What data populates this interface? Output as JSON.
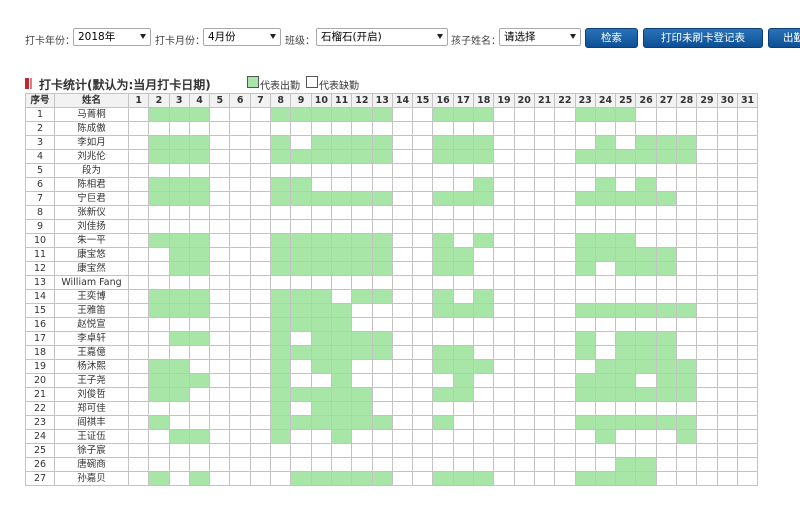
{
  "filters": {
    "year_label": "打卡年份：",
    "year_value": "2018年",
    "month_label": "打卡月份：",
    "month_value": "4月份",
    "class_label": "班级：",
    "class_value": "石榴石(开启)",
    "child_label": "孩子姓名：",
    "child_value": "请选择",
    "search_button": "检索",
    "print_button": "打印未刷卡登记表",
    "extra_button": "出勤"
  },
  "section": {
    "title": "打卡统计(默认为:当月打卡日期)",
    "legend_present": "代表出勤",
    "legend_absent": "代表缺勤"
  },
  "colors": {
    "present": "#a8e6a8",
    "absent": "#ffffff",
    "button": "#1560a8",
    "accent_red": "#c0282d"
  },
  "table": {
    "headers": {
      "seq": "序号",
      "name": "姓名"
    },
    "days": [
      "1",
      "2",
      "3",
      "4",
      "5",
      "6",
      "7",
      "8",
      "9",
      "10",
      "11",
      "12",
      "13",
      "14",
      "15",
      "16",
      "17",
      "18",
      "19",
      "20",
      "21",
      "22",
      "23",
      "24",
      "25",
      "26",
      "27",
      "28",
      "29",
      "30",
      "31"
    ],
    "rows": [
      {
        "seq": "1",
        "name": "马菁桐",
        "present": [
          2,
          3,
          4,
          8,
          9,
          10,
          11,
          12,
          13,
          16,
          17,
          18,
          23,
          24,
          25
        ]
      },
      {
        "seq": "2",
        "name": "陈成傲",
        "present": []
      },
      {
        "seq": "3",
        "name": "李如月",
        "present": [
          2,
          3,
          4,
          8,
          10,
          11,
          12,
          13,
          16,
          17,
          18,
          24,
          26,
          27,
          28
        ]
      },
      {
        "seq": "4",
        "name": "刘兆伦",
        "present": [
          2,
          3,
          4,
          8,
          9,
          10,
          11,
          12,
          13,
          16,
          17,
          18,
          23,
          24,
          25,
          26,
          27,
          28
        ]
      },
      {
        "seq": "5",
        "name": "段为",
        "present": []
      },
      {
        "seq": "6",
        "name": "陈相君",
        "present": [
          2,
          3,
          4,
          8,
          9,
          18,
          24,
          26
        ]
      },
      {
        "seq": "7",
        "name": "宁巨君",
        "present": [
          2,
          3,
          4,
          8,
          9,
          10,
          11,
          12,
          13,
          16,
          17,
          18,
          23,
          24,
          25,
          26,
          27
        ]
      },
      {
        "seq": "8",
        "name": "张新仪",
        "present": []
      },
      {
        "seq": "9",
        "name": "刘佳扬",
        "present": []
      },
      {
        "seq": "10",
        "name": "朱一平",
        "present": [
          2,
          3,
          4,
          8,
          9,
          10,
          11,
          12,
          13,
          16,
          18,
          23,
          24,
          25
        ]
      },
      {
        "seq": "11",
        "name": "康宝悠",
        "present": [
          3,
          4,
          8,
          9,
          10,
          11,
          12,
          13,
          16,
          17,
          23,
          24,
          25,
          26,
          27
        ]
      },
      {
        "seq": "12",
        "name": "康宝然",
        "present": [
          3,
          4,
          8,
          9,
          10,
          11,
          12,
          13,
          16,
          17,
          23,
          25,
          26,
          27
        ]
      },
      {
        "seq": "13",
        "name": "William Fang",
        "present": []
      },
      {
        "seq": "14",
        "name": "王奕博",
        "present": [
          2,
          3,
          4,
          8,
          9,
          10,
          12,
          13,
          16,
          18
        ]
      },
      {
        "seq": "15",
        "name": "王雅笛",
        "present": [
          2,
          3,
          4,
          8,
          9,
          10,
          11,
          16,
          17,
          18,
          23,
          24,
          25,
          26,
          27,
          28
        ]
      },
      {
        "seq": "16",
        "name": "赵悦宣",
        "present": [
          8,
          9,
          10,
          11
        ]
      },
      {
        "seq": "17",
        "name": "李卓轩",
        "present": [
          3,
          4,
          8,
          10,
          11,
          12,
          13,
          23,
          25,
          26,
          27
        ]
      },
      {
        "seq": "18",
        "name": "王嘉億",
        "present": [
          8,
          9,
          10,
          11,
          12,
          13,
          16,
          17,
          23,
          25,
          26,
          27
        ]
      },
      {
        "seq": "19",
        "name": "杨沐熙",
        "present": [
          2,
          3,
          8,
          10,
          11,
          16,
          17,
          18,
          24,
          25,
          26,
          27,
          28
        ]
      },
      {
        "seq": "20",
        "name": "王子尧",
        "present": [
          2,
          3,
          4,
          8,
          11,
          17,
          23,
          24,
          25,
          27,
          28
        ]
      },
      {
        "seq": "21",
        "name": "刘俊哲",
        "present": [
          2,
          3,
          8,
          9,
          10,
          11,
          12,
          16,
          17,
          23,
          24,
          25,
          26,
          27,
          28
        ]
      },
      {
        "seq": "22",
        "name": "郑可佳",
        "present": [
          8,
          10,
          11,
          12
        ]
      },
      {
        "seq": "23",
        "name": "阎祺丰",
        "present": [
          2,
          8,
          9,
          10,
          11,
          12,
          13,
          16,
          23,
          24,
          25,
          26,
          27,
          28
        ]
      },
      {
        "seq": "24",
        "name": "王证伍",
        "present": [
          3,
          4,
          8,
          11,
          24,
          28
        ]
      },
      {
        "seq": "25",
        "name": "徐子宸",
        "present": []
      },
      {
        "seq": "26",
        "name": "唐碗商",
        "present": [
          25,
          26
        ]
      },
      {
        "seq": "27",
        "name": "孙嘉贝",
        "present": [
          2,
          4,
          9,
          10,
          11,
          12,
          13,
          16,
          17,
          18,
          23,
          24,
          25,
          26
        ]
      }
    ]
  }
}
